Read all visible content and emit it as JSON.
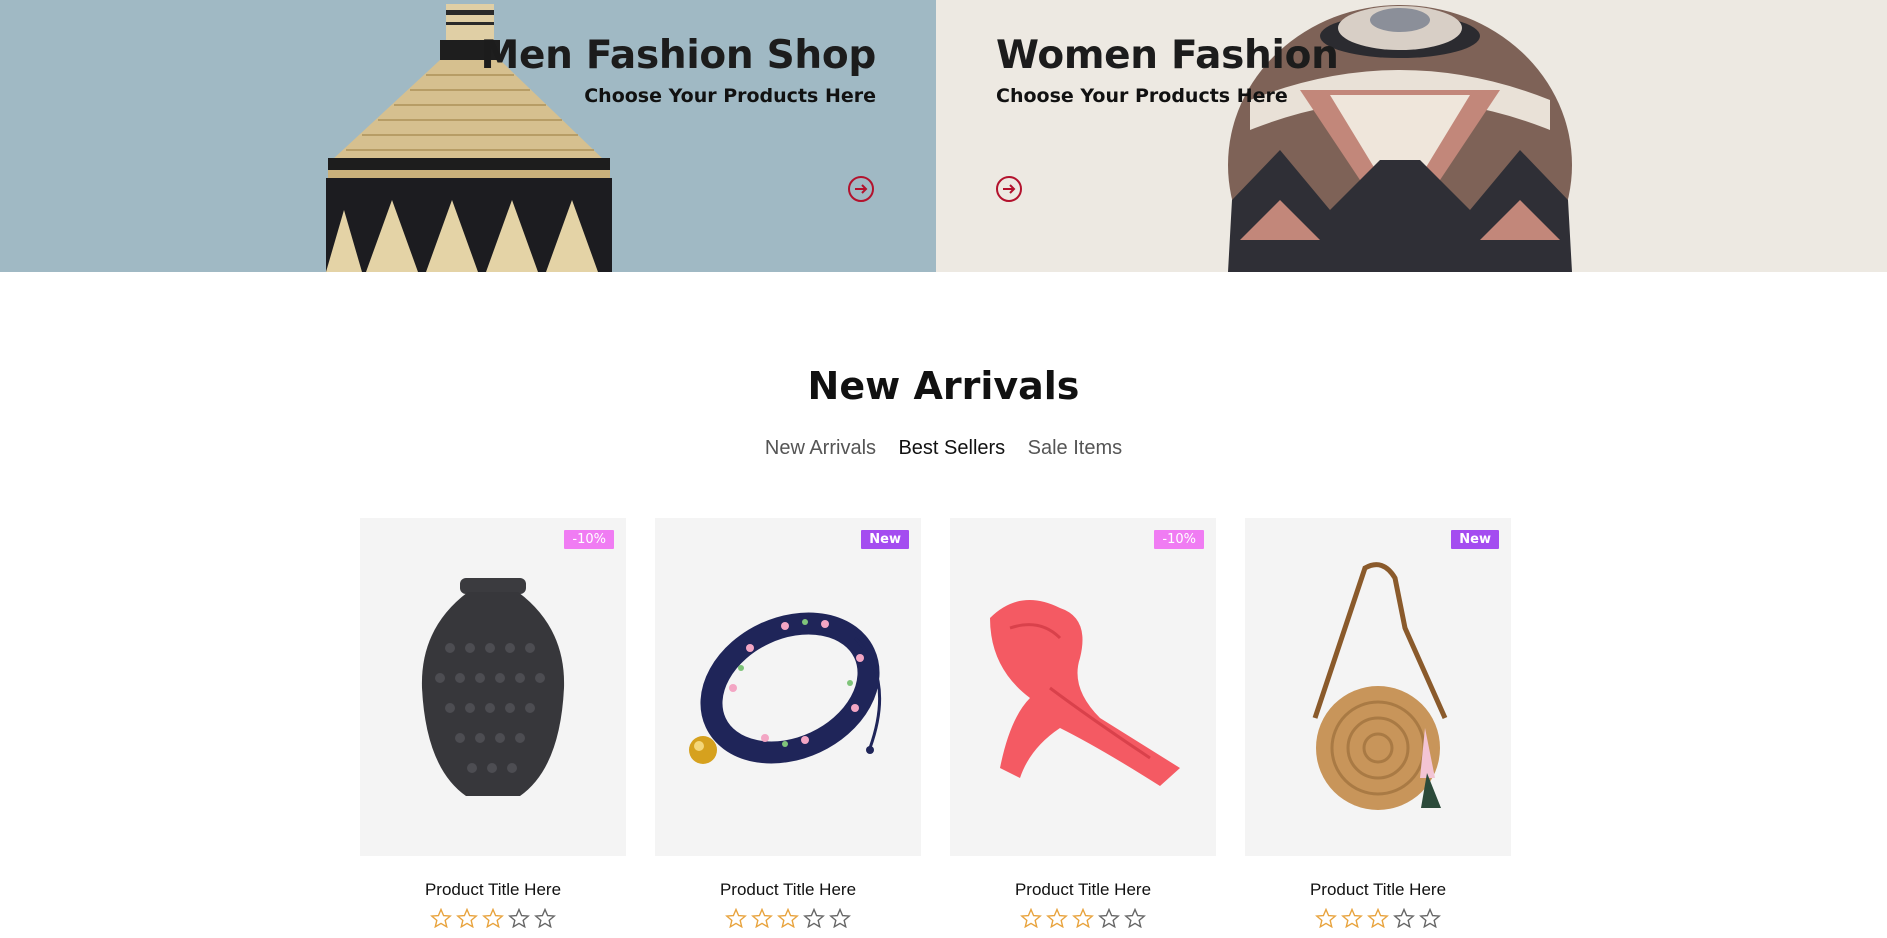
{
  "banners": {
    "men": {
      "title": "Men Fashion Shop",
      "subtitle": "Choose Your Products Here",
      "arrow_icon": "arrow-right-circle-icon"
    },
    "women": {
      "title": "Women Fashion",
      "subtitle": "Choose Your Products Here",
      "arrow_icon": "arrow-right-circle-icon"
    }
  },
  "section": {
    "title": "New Arrivals",
    "tabs": [
      {
        "label": "New Arrivals",
        "active": false
      },
      {
        "label": "Best Sellers",
        "active": true
      },
      {
        "label": "Sale Items",
        "active": false
      }
    ]
  },
  "products": [
    {
      "title": "Product Title Here",
      "badge": "-10%",
      "badge_type": "sale",
      "rating": 3,
      "max_rating": 5,
      "image": "black-vase"
    },
    {
      "title": "Product Title Here",
      "badge": "New",
      "badge_type": "new",
      "rating": 3,
      "max_rating": 5,
      "image": "floral-collar"
    },
    {
      "title": "Product Title Here",
      "badge": "-10%",
      "badge_type": "sale",
      "rating": 3,
      "max_rating": 5,
      "image": "red-scarf"
    },
    {
      "title": "Product Title Here",
      "badge": "New",
      "badge_type": "new",
      "rating": 3,
      "max_rating": 5,
      "image": "rattan-bag"
    }
  ],
  "colors": {
    "accent": "#b3122d",
    "badge_sale": "#f07cf3",
    "badge_new": "#a44cf0",
    "star": "#e8a33d",
    "star_empty": "#666666"
  }
}
